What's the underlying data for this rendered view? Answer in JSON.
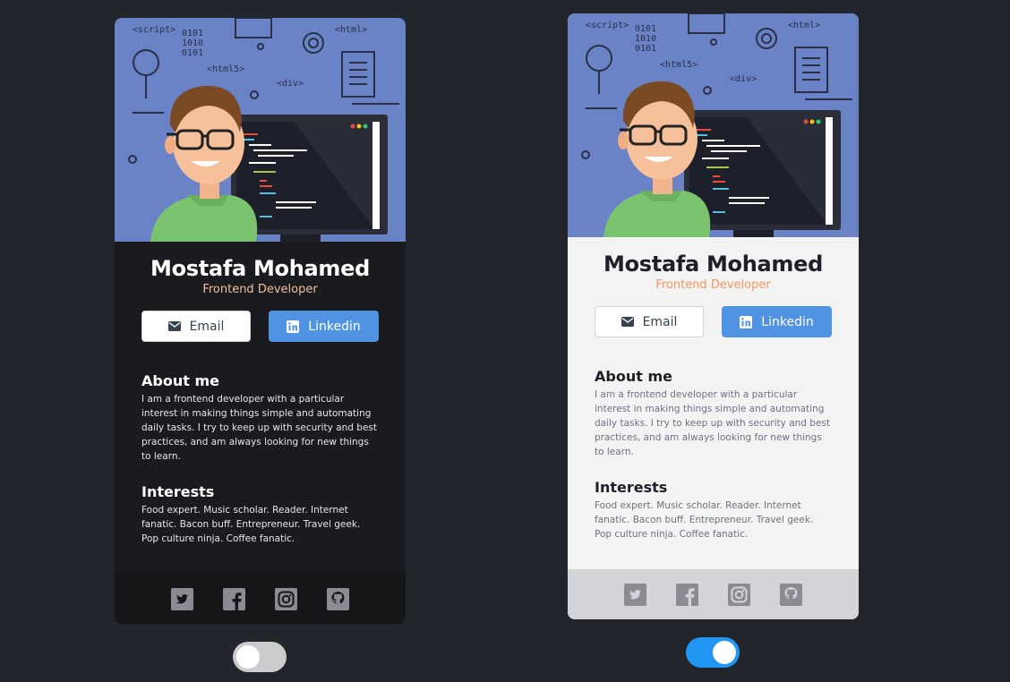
{
  "profile": {
    "name": "Mostafa Mohamed",
    "role": "Frontend Developer"
  },
  "buttons": {
    "email_label": "Email",
    "linkedin_label": "Linkedin"
  },
  "about": {
    "title": "About me",
    "text": "I am a frontend developer with a particular interest in making things simple and automating daily tasks. I try to keep up with security and best practices, and am always looking for new things to learn."
  },
  "interests": {
    "title": "Interests",
    "text": "Food expert. Music scholar. Reader. Internet fanatic. Bacon buff. Entrepreneur. Travel geek. Pop culture ninja. Coffee fanatic."
  },
  "hero": {
    "tag_script": "<script>",
    "tag_html": "<html>",
    "tag_html5": "<html5>",
    "tag_div": "<div>",
    "binary": [
      "0101",
      "1010",
      "0101"
    ]
  },
  "social": [
    "twitter-icon",
    "facebook-icon",
    "instagram-icon",
    "github-icon"
  ],
  "theme_toggles": [
    {
      "theme": "dark",
      "checked": false
    },
    {
      "theme": "light",
      "checked": true
    }
  ],
  "colors": {
    "page_bg": "#23252c",
    "hero_bg": "#6a83c7",
    "accent_orange": "#f3975f",
    "linkedin_blue": "#5093e2",
    "toggle_on": "#2196f3"
  }
}
